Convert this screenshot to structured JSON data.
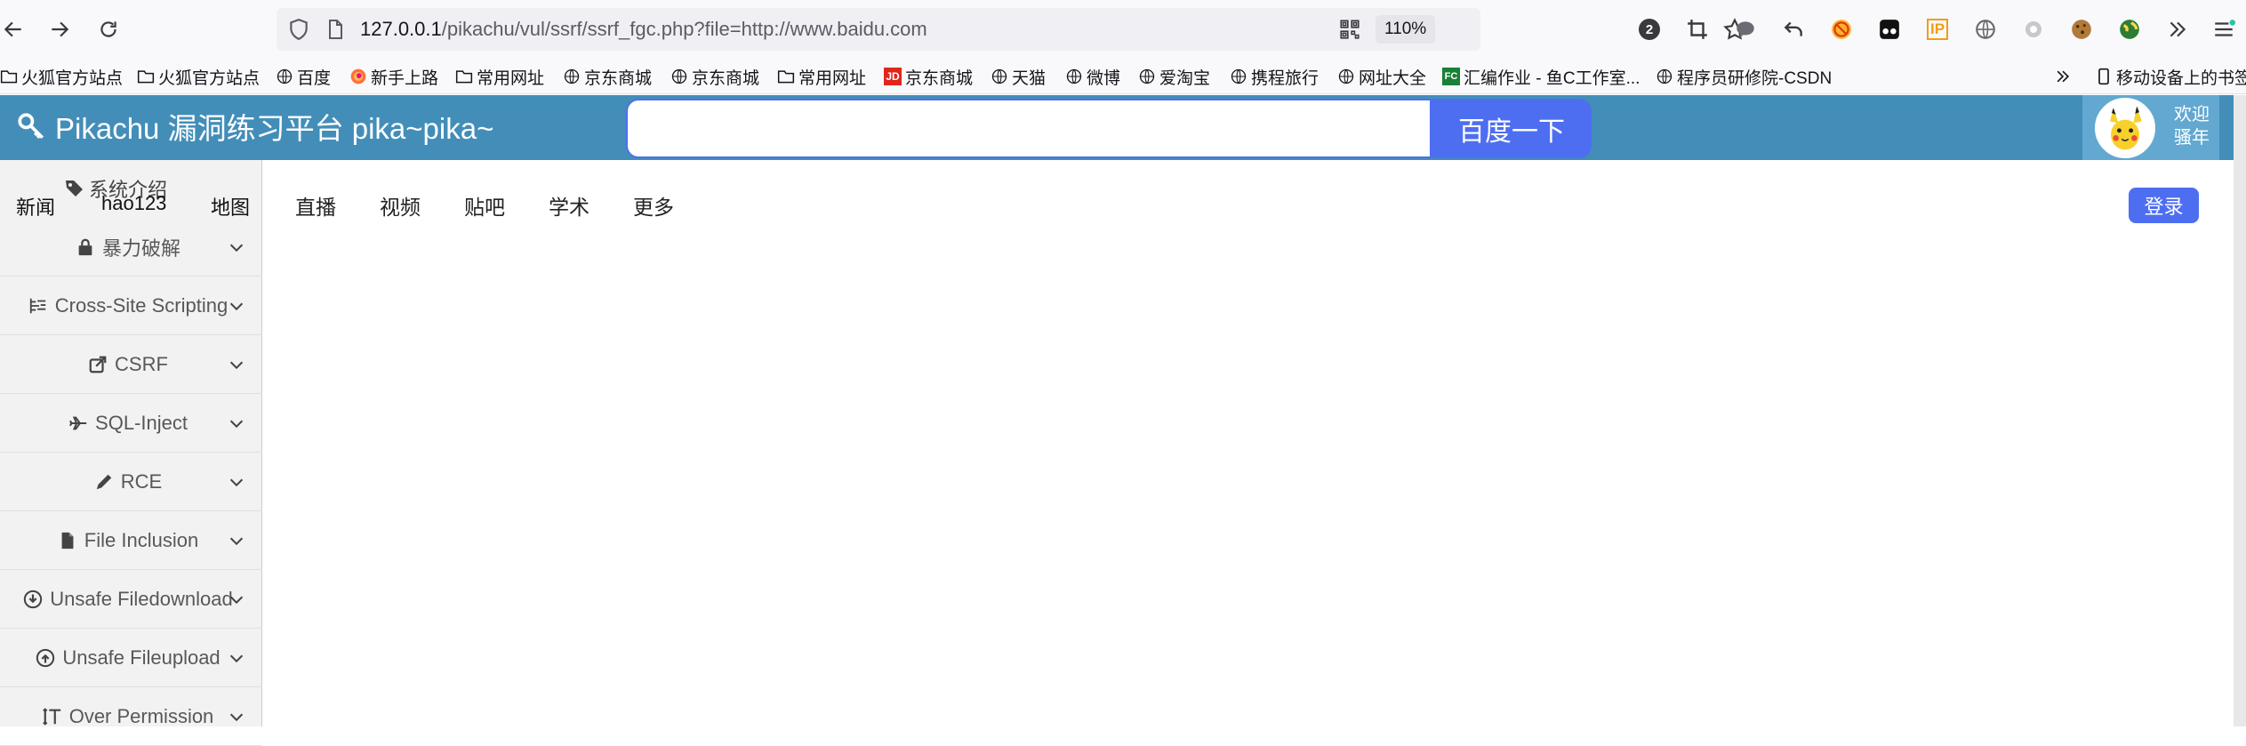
{
  "browser": {
    "url_host": "127.0.0.1",
    "url_rest": "/pikachu/vul/ssrf/ssrf_fgc.php?file=http://www.baidu.com",
    "zoom": "110%",
    "extension_badge": "2",
    "ip_label": "IP"
  },
  "bookmarks": [
    {
      "label": "火狐官方站点",
      "icon": "folder-icon"
    },
    {
      "label": "火狐官方站点",
      "icon": "folder-icon"
    },
    {
      "label": "百度",
      "icon": "globe-icon"
    },
    {
      "label": "新手上路",
      "icon": "firefox-icon"
    },
    {
      "label": "常用网址",
      "icon": "folder-icon"
    },
    {
      "label": "京东商城",
      "icon": "globe-icon"
    },
    {
      "label": "京东商城",
      "icon": "globe-icon"
    },
    {
      "label": "常用网址",
      "icon": "folder-icon"
    },
    {
      "label": "京东商城",
      "icon": "jd-icon"
    },
    {
      "label": "天猫",
      "icon": "globe-icon"
    },
    {
      "label": "微博",
      "icon": "globe-icon"
    },
    {
      "label": "爱淘宝",
      "icon": "globe-icon"
    },
    {
      "label": "携程旅行",
      "icon": "globe-icon"
    },
    {
      "label": "网址大全",
      "icon": "globe-icon"
    },
    {
      "label": "汇编作业 - 鱼C工作室...",
      "icon": "fc-icon"
    },
    {
      "label": "程序员研修院-CSDN",
      "icon": "globe-icon"
    }
  ],
  "bookmarks_mobile": "移动设备上的书签",
  "jd_text": "JD",
  "fc_text": "FC",
  "header": {
    "brand": "Pikachu 漏洞练习平台 pika~pika~",
    "search_button": "百度一下",
    "welcome_line1": "欢迎",
    "welcome_line2": "骚年"
  },
  "sidebar": {
    "top_links": [
      "新闻",
      "hao123",
      "地图"
    ],
    "intro": "系统介绍",
    "items": [
      {
        "label": "暴力破解",
        "icon": "lock-icon"
      },
      {
        "label": "Cross-Site Scripting",
        "icon": "list-icon"
      },
      {
        "label": "CSRF",
        "icon": "share-icon"
      },
      {
        "label": "SQL-Inject",
        "icon": "plane-icon"
      },
      {
        "label": "RCE",
        "icon": "pencil-icon"
      },
      {
        "label": "File Inclusion",
        "icon": "file-icon"
      },
      {
        "label": "Unsafe Filedownload",
        "icon": "download-icon"
      },
      {
        "label": "Unsafe Fileupload",
        "icon": "upload-icon"
      },
      {
        "label": "Over Permission",
        "icon": "text-height-icon"
      }
    ]
  },
  "content": {
    "nav": [
      "直播",
      "视频",
      "贴吧",
      "学术",
      "更多"
    ],
    "login": "登录"
  }
}
